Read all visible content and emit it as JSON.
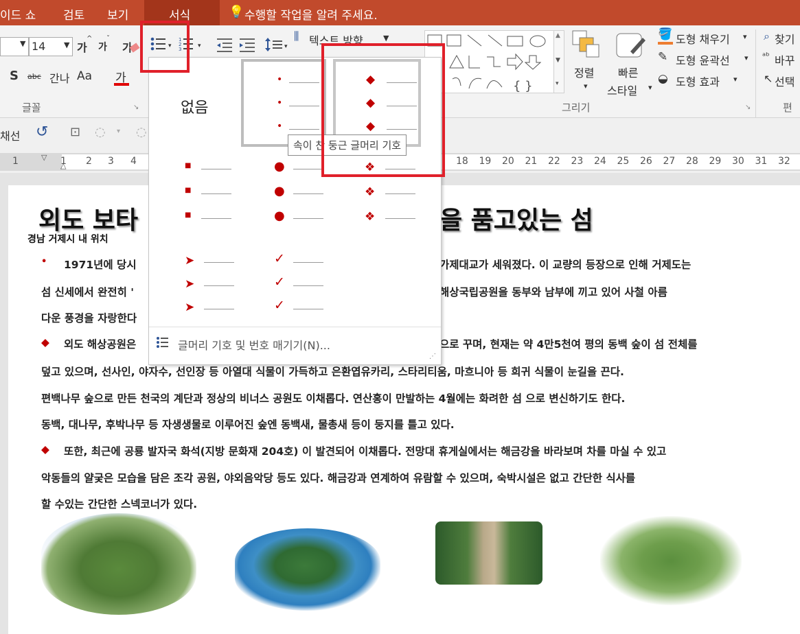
{
  "tabs": {
    "slideshow": "이드 쇼",
    "review": "검토",
    "view": "보기",
    "format": "서식",
    "tellme": "수행할 작업을 알려 주세요."
  },
  "ribbon": {
    "font_size": "14",
    "grow_font": "가",
    "shrink_font": "가",
    "clear_format": "가",
    "strike": "abc",
    "char_spacing": "간나",
    "change_case": "Aa",
    "font_color": "가",
    "text_direction": "텍스트 방향",
    "font_group": "글꼴",
    "draw_group": "그리기",
    "edit_group": "편",
    "arrange": "정렬",
    "quick_styles_line1": "빠른",
    "quick_styles_line2": "스타일",
    "shape_fill": "도형 채우기",
    "shape_outline": "도형 윤곽선",
    "shape_effects": "도형 효과",
    "find": "찾기",
    "replace": "바꾸",
    "select": "선택",
    "shape_glyphs": "{ }"
  },
  "qat": {
    "label": "채선"
  },
  "ruler": {
    "ticks_left": [
      "1",
      "1",
      "2",
      "3",
      "4"
    ],
    "ticks_right": [
      "18",
      "19",
      "20",
      "21",
      "22",
      "23",
      "24",
      "25",
      "26",
      "27",
      "28",
      "29",
      "30",
      "31",
      "32"
    ]
  },
  "gallery": {
    "none_label": "없음",
    "tooltip": "속이 찬 둥근 글머리 기호",
    "footer": "글머리 기호 및 번호 매기기(N)...",
    "glyphs": {
      "small_dot": "•",
      "diamond": "◆",
      "square": "■",
      "round": "●",
      "star4": "❖",
      "arrow": "➤",
      "check": "✓"
    }
  },
  "slide": {
    "title_left": "외도 보타",
    "title_right": "을 품고있는 섬",
    "subtitle": "경남 거제시 내 위치",
    "bullet_dot": "•",
    "bullet_diamond": "◆",
    "p1_l1_left": "1971년에 당시 ",
    "p1_l1_right": "가제대교가 세워졌다. 이 교량의 등장으로 인해 거제도는",
    "p1_l2_left": "섬 신세에서 완전히 '",
    "p1_l2_right": "해상국립공원을 동부와 남부에 끼고 있어 사철 아름",
    "p1_l3": "다운 풍경을 자랑한다",
    "p2_l1_left": "외도 해상공원은",
    "p2_l1_right": "으로 꾸며, 현재는 약 4만5천여 평의 동백 숲이 섬 전체를",
    "p2_l2": "덮고 있으며, 선사인, 야자수, 선인장 등 아열대 식물이 가득하고 은환엽유카리, 스타리티움, 마흐니아 등 희귀 식물이 눈길을 끈다.",
    "p2_l3": "편백나무 숲으로 만든 천국의 계단과 정상의 비너스 공원도 이채롭다. 연산홍이 만발하는 4월에는 화려한 섬 으로 변신하기도 한다.",
    "p2_l4": "동백, 대나무, 후박나무 등 자생생물로 이루어진  숲엔 동백새, 물총새 등이 둥지를 틀고 있다.",
    "p3_l1": "또한, 최근에 공룡 발자국 화석(지방 문화재 204호) 이 발견되어 이채롭다. 전망대 휴게실에서는 해금강을 바라보며 차를 마실 수 있고",
    "p3_l2": "악동들의 얄궂은 모습을 담은 조각 공원, 야외음악당 등도 있다. 해금강과 연계하여 유람할 수 있으며, 숙박시설은 없고 간단한 식사를",
    "p3_l3": "할 수있는 간단한 스넥코너가 있다."
  },
  "colors": {
    "tab_bar": "#c14a2c",
    "tab_active": "#a3351b",
    "bullet_red": "#c00000",
    "highlight": "#e0202a"
  }
}
